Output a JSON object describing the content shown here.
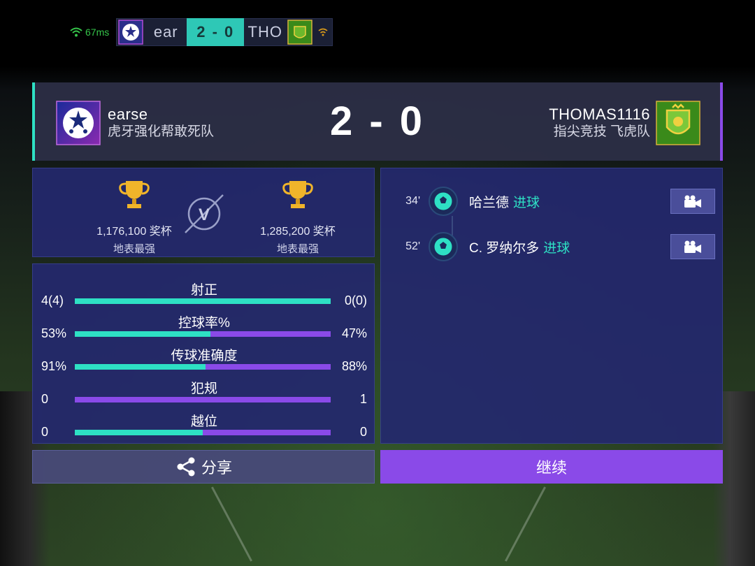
{
  "hud": {
    "ping": "67ms",
    "home_short": "ear",
    "score": "2 - 0",
    "away_short": "THO"
  },
  "header": {
    "score": "2 - 0",
    "home": {
      "name": "earse",
      "club": "虎牙强化帮敢死队"
    },
    "away": {
      "name": "THOMAS1116",
      "club": "指尖竞技 飞虎队"
    }
  },
  "cups": {
    "home": {
      "value": "1,176,100 奖杯",
      "rank": "地表最强"
    },
    "away": {
      "value": "1,285,200 奖杯",
      "rank": "地表最强"
    },
    "vs": "V"
  },
  "stats": [
    {
      "label": "射正",
      "home": "4(4)",
      "away": "0(0)",
      "home_share": 1.0
    },
    {
      "label": "控球率%",
      "home": "53%",
      "away": "47%",
      "home_share": 0.53
    },
    {
      "label": "传球准确度",
      "home": "91%",
      "away": "88%",
      "home_share": 0.51
    },
    {
      "label": "犯规",
      "home": "0",
      "away": "1",
      "home_share": 0.0
    },
    {
      "label": "越位",
      "home": "0",
      "away": "0",
      "home_share": 0.5
    }
  ],
  "events": [
    {
      "minute": "34'",
      "player": "哈兰德",
      "type": "进球"
    },
    {
      "minute": "52'",
      "player": "C. 罗纳尔多",
      "type": "进球"
    }
  ],
  "buttons": {
    "share": "分享",
    "continue": "继续"
  },
  "colors": {
    "accent_teal": "#2ee0c4",
    "accent_purple": "#8a4ae8",
    "panel": "#24286e"
  }
}
